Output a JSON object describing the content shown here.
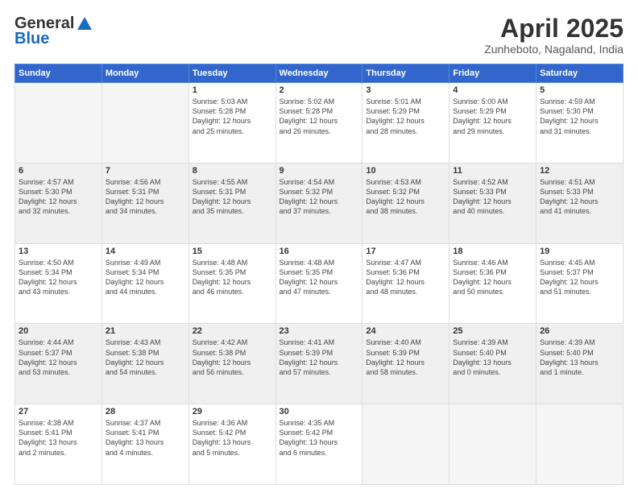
{
  "header": {
    "logo_general": "General",
    "logo_blue": "Blue",
    "title": "April 2025",
    "location": "Zunheboto, Nagaland, India"
  },
  "weekdays": [
    "Sunday",
    "Monday",
    "Tuesday",
    "Wednesday",
    "Thursday",
    "Friday",
    "Saturday"
  ],
  "weeks": [
    [
      {
        "day": "",
        "info": ""
      },
      {
        "day": "",
        "info": ""
      },
      {
        "day": "1",
        "info": "Sunrise: 5:03 AM\nSunset: 5:28 PM\nDaylight: 12 hours\nand 25 minutes."
      },
      {
        "day": "2",
        "info": "Sunrise: 5:02 AM\nSunset: 5:28 PM\nDaylight: 12 hours\nand 26 minutes."
      },
      {
        "day": "3",
        "info": "Sunrise: 5:01 AM\nSunset: 5:29 PM\nDaylight: 12 hours\nand 28 minutes."
      },
      {
        "day": "4",
        "info": "Sunrise: 5:00 AM\nSunset: 5:29 PM\nDaylight: 12 hours\nand 29 minutes."
      },
      {
        "day": "5",
        "info": "Sunrise: 4:59 AM\nSunset: 5:30 PM\nDaylight: 12 hours\nand 31 minutes."
      }
    ],
    [
      {
        "day": "6",
        "info": "Sunrise: 4:57 AM\nSunset: 5:30 PM\nDaylight: 12 hours\nand 32 minutes."
      },
      {
        "day": "7",
        "info": "Sunrise: 4:56 AM\nSunset: 5:31 PM\nDaylight: 12 hours\nand 34 minutes."
      },
      {
        "day": "8",
        "info": "Sunrise: 4:55 AM\nSunset: 5:31 PM\nDaylight: 12 hours\nand 35 minutes."
      },
      {
        "day": "9",
        "info": "Sunrise: 4:54 AM\nSunset: 5:32 PM\nDaylight: 12 hours\nand 37 minutes."
      },
      {
        "day": "10",
        "info": "Sunrise: 4:53 AM\nSunset: 5:32 PM\nDaylight: 12 hours\nand 38 minutes."
      },
      {
        "day": "11",
        "info": "Sunrise: 4:52 AM\nSunset: 5:33 PM\nDaylight: 12 hours\nand 40 minutes."
      },
      {
        "day": "12",
        "info": "Sunrise: 4:51 AM\nSunset: 5:33 PM\nDaylight: 12 hours\nand 41 minutes."
      }
    ],
    [
      {
        "day": "13",
        "info": "Sunrise: 4:50 AM\nSunset: 5:34 PM\nDaylight: 12 hours\nand 43 minutes."
      },
      {
        "day": "14",
        "info": "Sunrise: 4:49 AM\nSunset: 5:34 PM\nDaylight: 12 hours\nand 44 minutes."
      },
      {
        "day": "15",
        "info": "Sunrise: 4:48 AM\nSunset: 5:35 PM\nDaylight: 12 hours\nand 46 minutes."
      },
      {
        "day": "16",
        "info": "Sunrise: 4:48 AM\nSunset: 5:35 PM\nDaylight: 12 hours\nand 47 minutes."
      },
      {
        "day": "17",
        "info": "Sunrise: 4:47 AM\nSunset: 5:36 PM\nDaylight: 12 hours\nand 48 minutes."
      },
      {
        "day": "18",
        "info": "Sunrise: 4:46 AM\nSunset: 5:36 PM\nDaylight: 12 hours\nand 50 minutes."
      },
      {
        "day": "19",
        "info": "Sunrise: 4:45 AM\nSunset: 5:37 PM\nDaylight: 12 hours\nand 51 minutes."
      }
    ],
    [
      {
        "day": "20",
        "info": "Sunrise: 4:44 AM\nSunset: 5:37 PM\nDaylight: 12 hours\nand 53 minutes."
      },
      {
        "day": "21",
        "info": "Sunrise: 4:43 AM\nSunset: 5:38 PM\nDaylight: 12 hours\nand 54 minutes."
      },
      {
        "day": "22",
        "info": "Sunrise: 4:42 AM\nSunset: 5:38 PM\nDaylight: 12 hours\nand 56 minutes."
      },
      {
        "day": "23",
        "info": "Sunrise: 4:41 AM\nSunset: 5:39 PM\nDaylight: 12 hours\nand 57 minutes."
      },
      {
        "day": "24",
        "info": "Sunrise: 4:40 AM\nSunset: 5:39 PM\nDaylight: 12 hours\nand 58 minutes."
      },
      {
        "day": "25",
        "info": "Sunrise: 4:39 AM\nSunset: 5:40 PM\nDaylight: 13 hours\nand 0 minutes."
      },
      {
        "day": "26",
        "info": "Sunrise: 4:39 AM\nSunset: 5:40 PM\nDaylight: 13 hours\nand 1 minute."
      }
    ],
    [
      {
        "day": "27",
        "info": "Sunrise: 4:38 AM\nSunset: 5:41 PM\nDaylight: 13 hours\nand 2 minutes."
      },
      {
        "day": "28",
        "info": "Sunrise: 4:37 AM\nSunset: 5:41 PM\nDaylight: 13 hours\nand 4 minutes."
      },
      {
        "day": "29",
        "info": "Sunrise: 4:36 AM\nSunset: 5:42 PM\nDaylight: 13 hours\nand 5 minutes."
      },
      {
        "day": "30",
        "info": "Sunrise: 4:35 AM\nSunset: 5:42 PM\nDaylight: 13 hours\nand 6 minutes."
      },
      {
        "day": "",
        "info": ""
      },
      {
        "day": "",
        "info": ""
      },
      {
        "day": "",
        "info": ""
      }
    ]
  ]
}
